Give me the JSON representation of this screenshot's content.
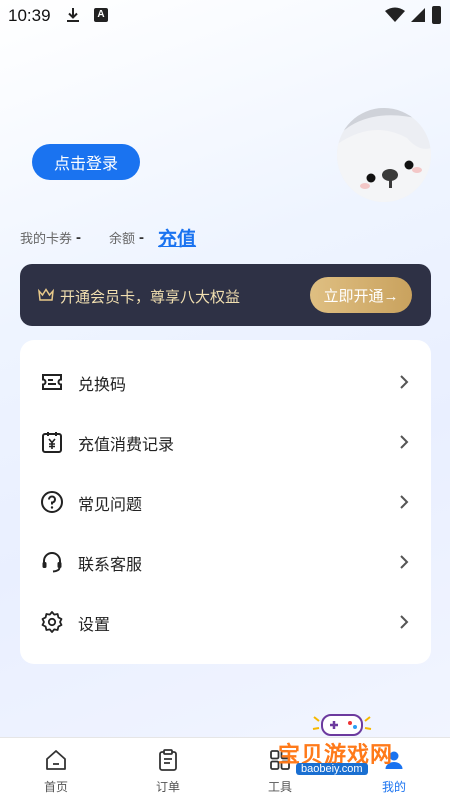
{
  "status_bar": {
    "time": "10:39",
    "a_badge": "A"
  },
  "header": {
    "login_label": "点击登录"
  },
  "account": {
    "cards_label": "我的卡券",
    "cards_value": "-",
    "balance_label": "余额",
    "balance_value": "-",
    "recharge_label": "充值"
  },
  "vip": {
    "text": "开通会员卡，尊享八大权益",
    "button_label": "立即开通→"
  },
  "menu": {
    "items": [
      {
        "label": "兑换码",
        "icon": "ticket-icon"
      },
      {
        "label": "充值消费记录",
        "icon": "calendar-yen-icon"
      },
      {
        "label": "常见问题",
        "icon": "question-icon"
      },
      {
        "label": "联系客服",
        "icon": "headset-icon"
      },
      {
        "label": "设置",
        "icon": "gear-icon"
      }
    ]
  },
  "tabs": [
    {
      "label": "首页",
      "icon": "home-icon"
    },
    {
      "label": "订单",
      "icon": "order-icon"
    },
    {
      "label": "工具",
      "icon": "tools-icon"
    },
    {
      "label": "我的",
      "icon": "profile-icon",
      "active": true
    }
  ],
  "watermark": {
    "title": "宝贝游戏网",
    "url": "baobeiy.com"
  },
  "colors": {
    "accent": "#1a73f0",
    "vip_bg": "#2e3145",
    "vip_gold": "#d6b374"
  }
}
